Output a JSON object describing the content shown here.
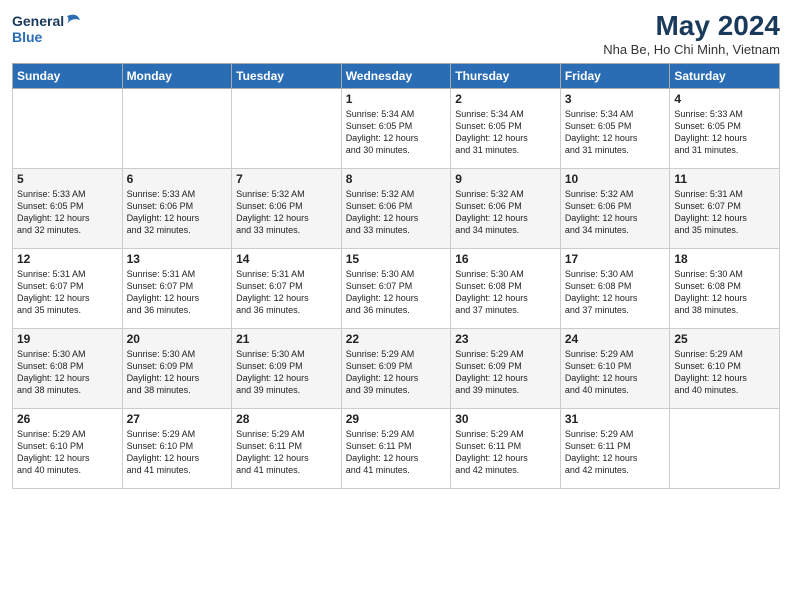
{
  "header": {
    "logo_line1": "General",
    "logo_line2": "Blue",
    "month_year": "May 2024",
    "location": "Nha Be, Ho Chi Minh, Vietnam"
  },
  "days_of_week": [
    "Sunday",
    "Monday",
    "Tuesday",
    "Wednesday",
    "Thursday",
    "Friday",
    "Saturday"
  ],
  "weeks": [
    [
      {
        "day": "",
        "info": ""
      },
      {
        "day": "",
        "info": ""
      },
      {
        "day": "",
        "info": ""
      },
      {
        "day": "1",
        "info": "Sunrise: 5:34 AM\nSunset: 6:05 PM\nDaylight: 12 hours\nand 30 minutes."
      },
      {
        "day": "2",
        "info": "Sunrise: 5:34 AM\nSunset: 6:05 PM\nDaylight: 12 hours\nand 31 minutes."
      },
      {
        "day": "3",
        "info": "Sunrise: 5:34 AM\nSunset: 6:05 PM\nDaylight: 12 hours\nand 31 minutes."
      },
      {
        "day": "4",
        "info": "Sunrise: 5:33 AM\nSunset: 6:05 PM\nDaylight: 12 hours\nand 31 minutes."
      }
    ],
    [
      {
        "day": "5",
        "info": "Sunrise: 5:33 AM\nSunset: 6:05 PM\nDaylight: 12 hours\nand 32 minutes."
      },
      {
        "day": "6",
        "info": "Sunrise: 5:33 AM\nSunset: 6:06 PM\nDaylight: 12 hours\nand 32 minutes."
      },
      {
        "day": "7",
        "info": "Sunrise: 5:32 AM\nSunset: 6:06 PM\nDaylight: 12 hours\nand 33 minutes."
      },
      {
        "day": "8",
        "info": "Sunrise: 5:32 AM\nSunset: 6:06 PM\nDaylight: 12 hours\nand 33 minutes."
      },
      {
        "day": "9",
        "info": "Sunrise: 5:32 AM\nSunset: 6:06 PM\nDaylight: 12 hours\nand 34 minutes."
      },
      {
        "day": "10",
        "info": "Sunrise: 5:32 AM\nSunset: 6:06 PM\nDaylight: 12 hours\nand 34 minutes."
      },
      {
        "day": "11",
        "info": "Sunrise: 5:31 AM\nSunset: 6:07 PM\nDaylight: 12 hours\nand 35 minutes."
      }
    ],
    [
      {
        "day": "12",
        "info": "Sunrise: 5:31 AM\nSunset: 6:07 PM\nDaylight: 12 hours\nand 35 minutes."
      },
      {
        "day": "13",
        "info": "Sunrise: 5:31 AM\nSunset: 6:07 PM\nDaylight: 12 hours\nand 36 minutes."
      },
      {
        "day": "14",
        "info": "Sunrise: 5:31 AM\nSunset: 6:07 PM\nDaylight: 12 hours\nand 36 minutes."
      },
      {
        "day": "15",
        "info": "Sunrise: 5:30 AM\nSunset: 6:07 PM\nDaylight: 12 hours\nand 36 minutes."
      },
      {
        "day": "16",
        "info": "Sunrise: 5:30 AM\nSunset: 6:08 PM\nDaylight: 12 hours\nand 37 minutes."
      },
      {
        "day": "17",
        "info": "Sunrise: 5:30 AM\nSunset: 6:08 PM\nDaylight: 12 hours\nand 37 minutes."
      },
      {
        "day": "18",
        "info": "Sunrise: 5:30 AM\nSunset: 6:08 PM\nDaylight: 12 hours\nand 38 minutes."
      }
    ],
    [
      {
        "day": "19",
        "info": "Sunrise: 5:30 AM\nSunset: 6:08 PM\nDaylight: 12 hours\nand 38 minutes."
      },
      {
        "day": "20",
        "info": "Sunrise: 5:30 AM\nSunset: 6:09 PM\nDaylight: 12 hours\nand 38 minutes."
      },
      {
        "day": "21",
        "info": "Sunrise: 5:30 AM\nSunset: 6:09 PM\nDaylight: 12 hours\nand 39 minutes."
      },
      {
        "day": "22",
        "info": "Sunrise: 5:29 AM\nSunset: 6:09 PM\nDaylight: 12 hours\nand 39 minutes."
      },
      {
        "day": "23",
        "info": "Sunrise: 5:29 AM\nSunset: 6:09 PM\nDaylight: 12 hours\nand 39 minutes."
      },
      {
        "day": "24",
        "info": "Sunrise: 5:29 AM\nSunset: 6:10 PM\nDaylight: 12 hours\nand 40 minutes."
      },
      {
        "day": "25",
        "info": "Sunrise: 5:29 AM\nSunset: 6:10 PM\nDaylight: 12 hours\nand 40 minutes."
      }
    ],
    [
      {
        "day": "26",
        "info": "Sunrise: 5:29 AM\nSunset: 6:10 PM\nDaylight: 12 hours\nand 40 minutes."
      },
      {
        "day": "27",
        "info": "Sunrise: 5:29 AM\nSunset: 6:10 PM\nDaylight: 12 hours\nand 41 minutes."
      },
      {
        "day": "28",
        "info": "Sunrise: 5:29 AM\nSunset: 6:11 PM\nDaylight: 12 hours\nand 41 minutes."
      },
      {
        "day": "29",
        "info": "Sunrise: 5:29 AM\nSunset: 6:11 PM\nDaylight: 12 hours\nand 41 minutes."
      },
      {
        "day": "30",
        "info": "Sunrise: 5:29 AM\nSunset: 6:11 PM\nDaylight: 12 hours\nand 42 minutes."
      },
      {
        "day": "31",
        "info": "Sunrise: 5:29 AM\nSunset: 6:11 PM\nDaylight: 12 hours\nand 42 minutes."
      },
      {
        "day": "",
        "info": ""
      }
    ]
  ]
}
